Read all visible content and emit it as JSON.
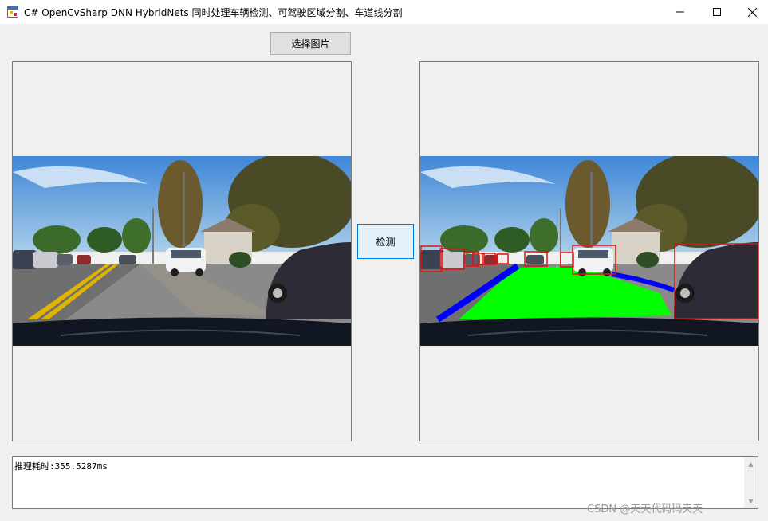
{
  "window": {
    "title": "C# OpenCvSharp DNN HybridNets 同时处理车辆检测、可驾驶区域分割、车道线分割",
    "app_icon": "winforms-app-icon",
    "controls": {
      "minimize_icon": "minimize-icon",
      "maximize_icon": "maximize-icon",
      "close_icon": "close-icon"
    }
  },
  "toolbar": {
    "select_image_label": "选择图片"
  },
  "detect_button": {
    "label": "检测"
  },
  "left_picture": {
    "content": "road-scene-original"
  },
  "right_picture": {
    "content": "road-scene-detection-result",
    "colors": {
      "drivable_area": "#00ff00",
      "lane_line": "#0000ff",
      "vehicle_box": "#e01010"
    }
  },
  "output": {
    "text": "推理耗时:355.5287ms"
  },
  "watermark": {
    "text": "CSDN @天天代码码天天"
  }
}
